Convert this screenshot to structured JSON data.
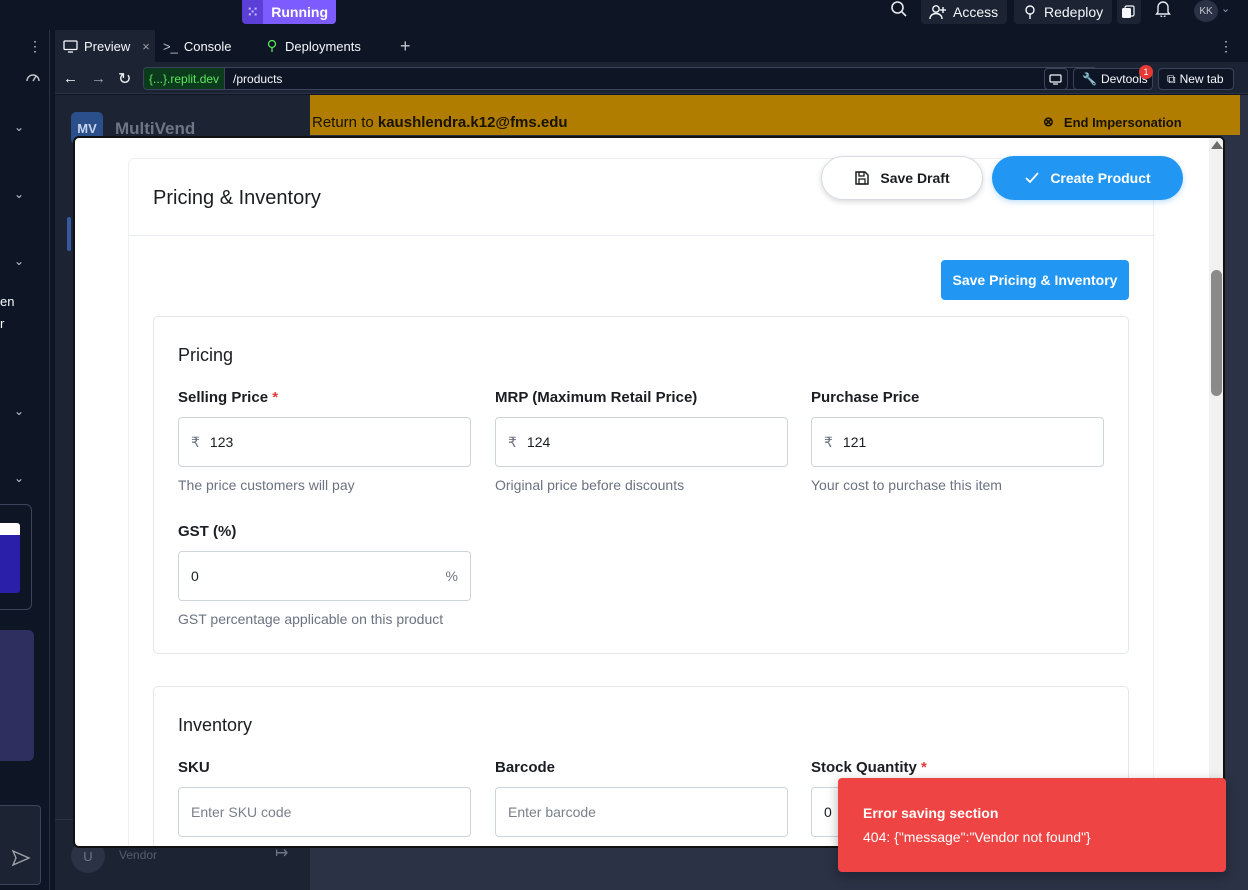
{
  "topbar": {
    "status_label": "Running",
    "access_label": "Access",
    "redeploy_label": "Redeploy",
    "avatar_initials": "KK"
  },
  "sidebar_fragments": {
    "text1": "en",
    "text2": "r"
  },
  "tabs": [
    {
      "label": "Preview",
      "active": true
    },
    {
      "label": "Console",
      "active": false
    },
    {
      "label": "Deployments",
      "active": false
    }
  ],
  "address": {
    "host": "{...}.replit.dev",
    "path": "/products",
    "devtools_label": "Devtools",
    "devtools_badge": "1",
    "newtab_label": "New tab"
  },
  "app": {
    "logo_initials": "MV",
    "brand": "MultiVend",
    "impersonation_prefix": "Return to",
    "impersonation_email": "kaushlendra.k12@fms.edu",
    "end_impersonation": "End Impersonation",
    "footer_avatar": "U",
    "footer_role": "Vendor"
  },
  "modal": {
    "title": "Pricing & Inventory",
    "save_draft": "Save Draft",
    "create_product": "Create Product",
    "save_section": "Save Pricing & Inventory",
    "pricing": {
      "heading": "Pricing",
      "selling_price": {
        "label": "Selling Price",
        "required": "*",
        "currency": "₹",
        "value": "123",
        "help": "The price customers will pay"
      },
      "mrp": {
        "label": "MRP (Maximum Retail Price)",
        "currency": "₹",
        "value": "124",
        "help": "Original price before discounts"
      },
      "purchase_price": {
        "label": "Purchase Price",
        "currency": "₹",
        "value": "121",
        "help": "Your cost to purchase this item"
      },
      "gst": {
        "label": "GST (%)",
        "value": "0",
        "suffix": "%",
        "help": "GST percentage applicable on this product"
      }
    },
    "inventory": {
      "heading": "Inventory",
      "sku": {
        "label": "SKU",
        "placeholder": "Enter SKU code"
      },
      "barcode": {
        "label": "Barcode",
        "placeholder": "Enter barcode"
      },
      "stock": {
        "label": "Stock Quantity",
        "required": "*",
        "value": "0"
      }
    }
  },
  "toast": {
    "title": "Error saving section",
    "message": "404: {\"message\":\"Vendor not found\"}"
  },
  "colors": {
    "primary": "#2196f3",
    "error": "#ef4444",
    "replit_running": "#7c5cff",
    "impersonation_bar": "#b07d00"
  }
}
